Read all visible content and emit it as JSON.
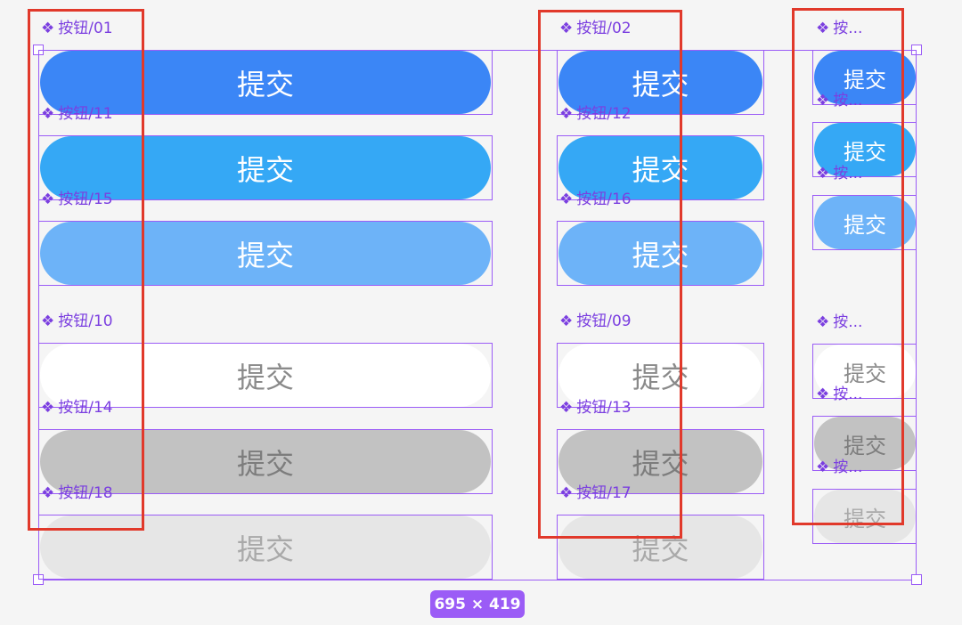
{
  "button_text": "提交",
  "labels": {
    "l01": "按钮/01",
    "l11": "按钮/11",
    "l15": "按钮/15",
    "l10": "按钮/10",
    "l14": "按钮/14",
    "l18": "按钮/18",
    "l02": "按钮/02",
    "l12": "按钮/12",
    "l16": "按钮/16",
    "l09": "按钮/09",
    "l13": "按钮/13",
    "l17": "按钮/17",
    "s1": "按...",
    "s2": "按...",
    "s3": "按...",
    "s4": "按...",
    "s5": "按...",
    "s6": "按..."
  },
  "component_icon": "diamond-component-icon",
  "dimension_badge": "695 × 419",
  "colors": {
    "blue_primary": "#3b86f6",
    "blue_light": "#35a8f5",
    "blue_pale": "#6db3f8",
    "white": "#ffffff",
    "gray": "#c2c2c2",
    "gray_light": "#e6e6e6",
    "selection_purple": "#9b5cf6",
    "highlight_red": "#e1392b"
  }
}
